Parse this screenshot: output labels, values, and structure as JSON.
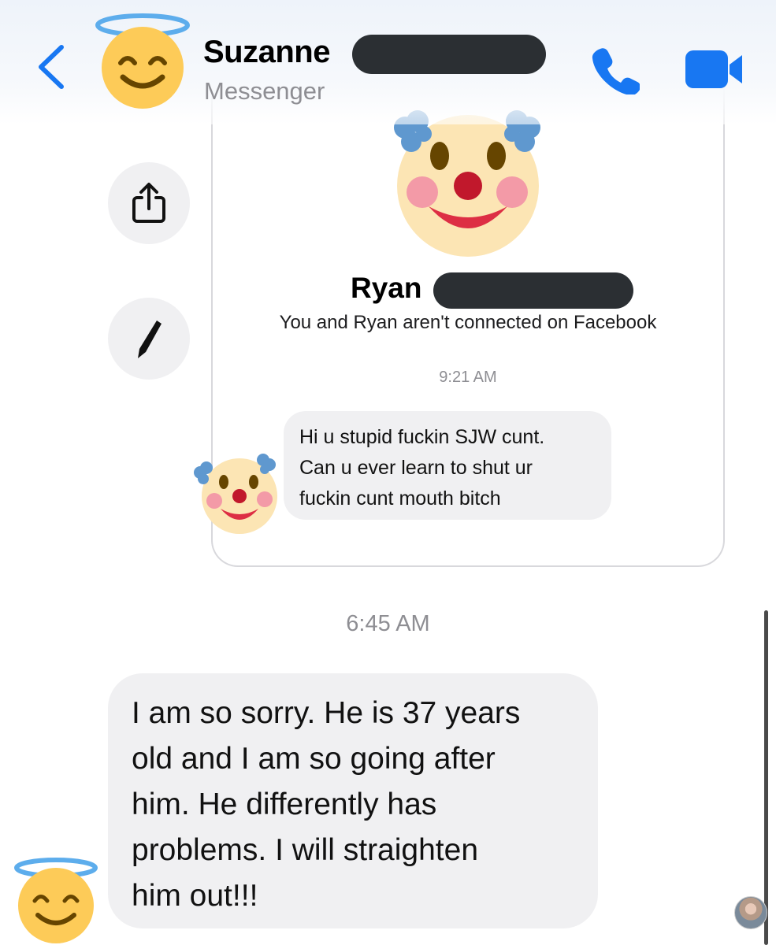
{
  "header": {
    "contact_name": "Suzanne",
    "subtitle": "Messenger",
    "back_icon": "chevron-left-icon",
    "call_icon": "phone-icon",
    "video_icon": "video-camera-icon",
    "accent_color": "#1877f2"
  },
  "side_actions": [
    {
      "icon": "share-icon"
    },
    {
      "icon": "pencil-icon"
    }
  ],
  "card": {
    "name": "Ryan",
    "connection_note": "You and Ryan aren't connected on Facebook",
    "timestamp": "9:21 AM",
    "message_lines": [
      "Hi u stupid fuckin SJW cunt.",
      "Can u ever learn to shut ur",
      "fuckin cunt mouth bitch"
    ]
  },
  "thread": {
    "timestamp": "6:45 AM",
    "message_lines": [
      "I am so sorry. He is 37 years",
      "old and I am so going after",
      "him. He differently has",
      "problems. I will straighten",
      "him out!!!"
    ]
  },
  "colors": {
    "bubble_bg": "#f0f0f2",
    "redaction": "#2b2f33",
    "emoji_face": "#fdcb58",
    "halo": "#5dadec"
  }
}
